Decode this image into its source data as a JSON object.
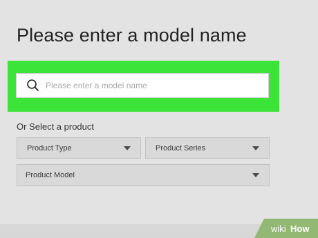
{
  "page": {
    "title": "Please enter a model name"
  },
  "search": {
    "placeholder": "Please enter a model name",
    "icon": "search-icon"
  },
  "product_select": {
    "label": "Or Select a product",
    "type_select": "Product Type",
    "series_select": "Product Series",
    "model_select": "Product Model"
  },
  "watermark": {
    "text_wiki": "wiki",
    "text_how": "How"
  },
  "colors": {
    "highlight": "#3ce43a",
    "background": "#e3e3e3",
    "watermark": "#93b874"
  }
}
